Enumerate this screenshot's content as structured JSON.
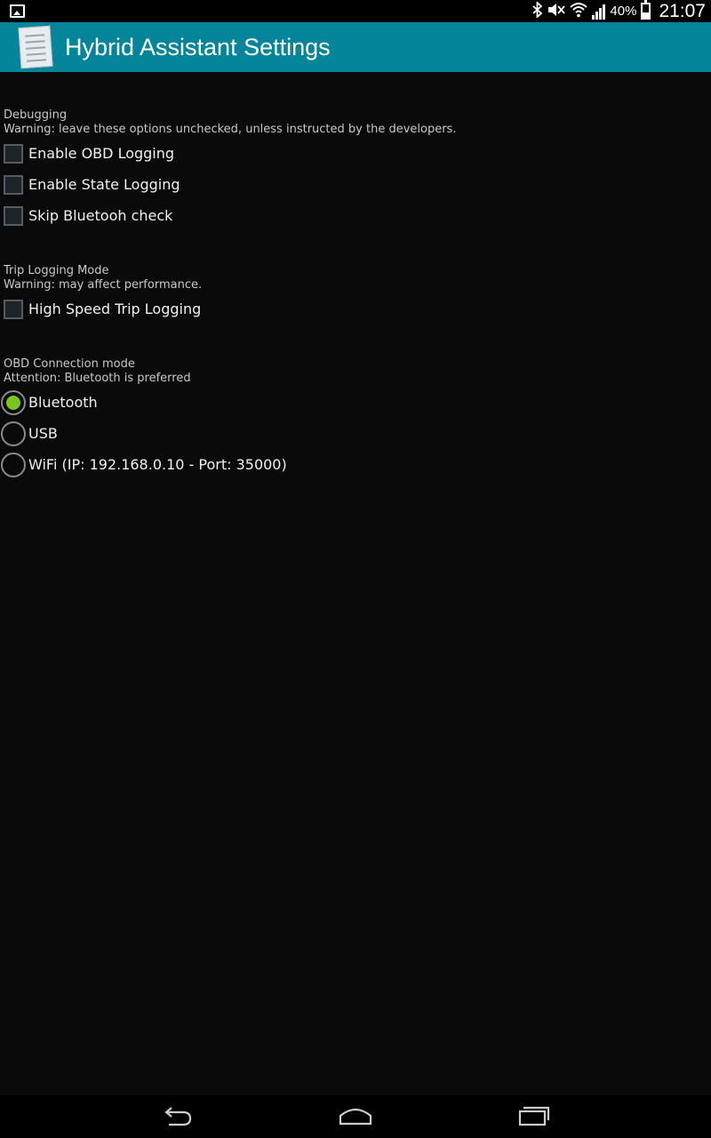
{
  "status_bar": {
    "left_icon": "image-icon",
    "icons": [
      "bluetooth-icon",
      "mute-icon",
      "wifi-icon",
      "signal-icon"
    ],
    "battery_percent": "40%",
    "time": "21:07"
  },
  "action_bar": {
    "app_icon": "app-icon",
    "title": "Hybrid Assistant Settings",
    "background_color": "#058599"
  },
  "debugging": {
    "title": "Debugging",
    "warning": "Warning: leave these options unchecked, unless instructed by the developers.",
    "options": [
      {
        "label": "Enable OBD Logging",
        "checked": false
      },
      {
        "label": "Enable State Logging",
        "checked": false
      },
      {
        "label": "Skip Bluetooh check",
        "checked": false
      }
    ]
  },
  "trip_logging": {
    "title": "Trip Logging Mode",
    "warning": "Warning: may affect performance.",
    "options": [
      {
        "label": "High Speed Trip Logging",
        "checked": false
      }
    ]
  },
  "obd_connection": {
    "title": "OBD Connection mode",
    "attention": "Attention: Bluetooth is preferred",
    "options": [
      {
        "label": "Bluetooth",
        "selected": true
      },
      {
        "label": "USB",
        "selected": false
      },
      {
        "label": "WiFi (IP: 192.168.0.10 - Port: 35000)",
        "selected": false
      }
    ],
    "selected_color": "#7ac51b"
  },
  "nav_bar": {
    "icons": [
      "back-icon",
      "home-icon",
      "recent-apps-icon"
    ]
  }
}
